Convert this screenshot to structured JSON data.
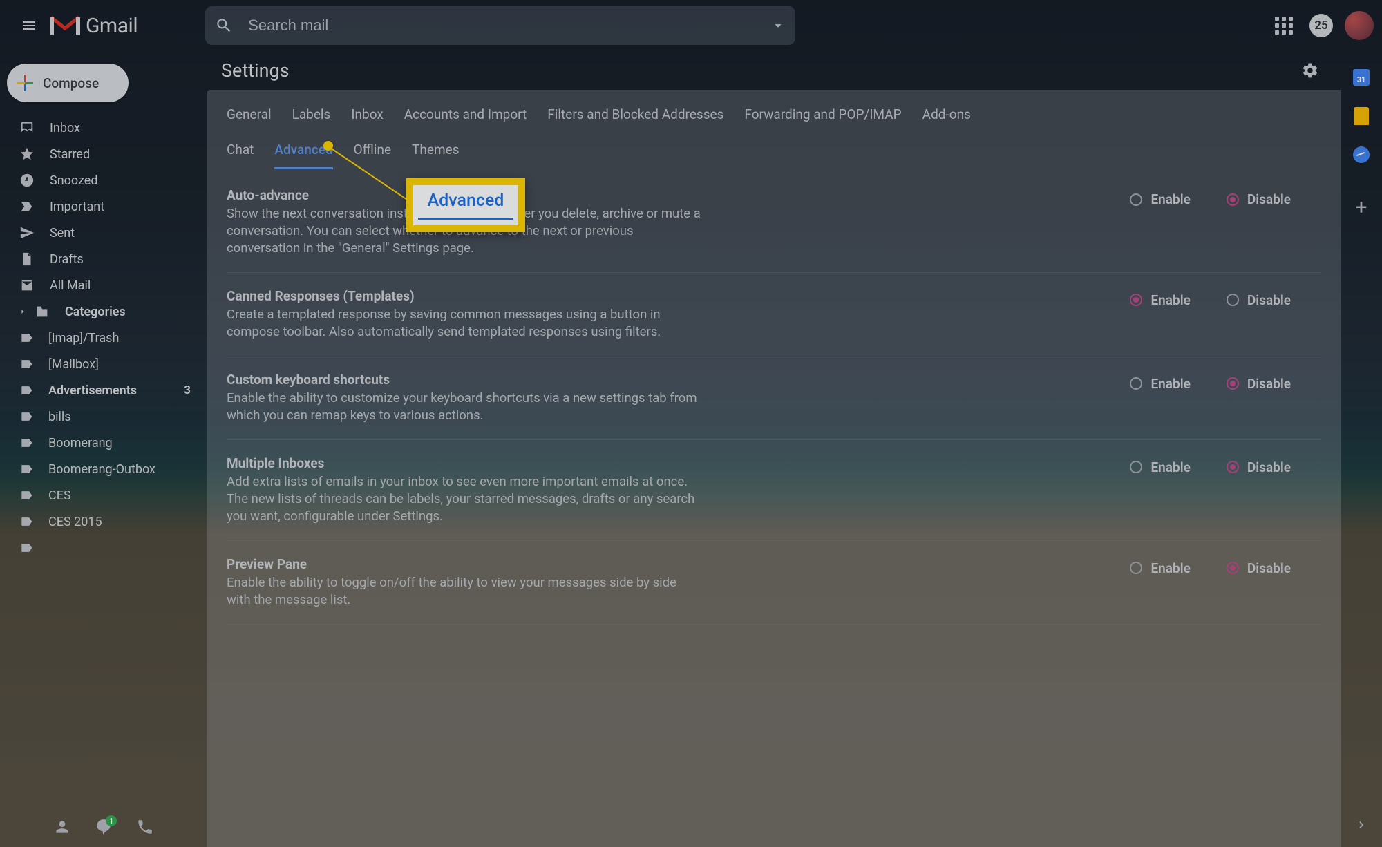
{
  "header": {
    "logo_text": "Gmail",
    "search_placeholder": "Search mail",
    "notif_count": "25"
  },
  "compose_label": "Compose",
  "sidebar": {
    "items": [
      {
        "label": "Inbox",
        "icon": "inbox"
      },
      {
        "label": "Starred",
        "icon": "star"
      },
      {
        "label": "Snoozed",
        "icon": "clock"
      },
      {
        "label": "Important",
        "icon": "important"
      },
      {
        "label": "Sent",
        "icon": "send"
      },
      {
        "label": "Drafts",
        "icon": "draft"
      },
      {
        "label": "All Mail",
        "icon": "mail"
      },
      {
        "label": "Categories",
        "icon": "cat",
        "bold": true,
        "expand": true
      },
      {
        "label": "[Imap]/Trash",
        "icon": "label"
      },
      {
        "label": "[Mailbox]",
        "icon": "label"
      },
      {
        "label": "Advertisements",
        "icon": "label",
        "bold": true,
        "count": "3"
      },
      {
        "label": "bills",
        "icon": "label"
      },
      {
        "label": "Boomerang",
        "icon": "label"
      },
      {
        "label": "Boomerang-Outbox",
        "icon": "label"
      },
      {
        "label": "CES",
        "icon": "label"
      },
      {
        "label": "CES 2015",
        "icon": "label"
      },
      {
        "label": "",
        "icon": "label"
      }
    ],
    "hangouts_count": "1"
  },
  "settings_title": "Settings",
  "tabs_row1": [
    "General",
    "Labels",
    "Inbox",
    "Accounts and Import",
    "Filters and Blocked Addresses",
    "Forwarding and POP/IMAP",
    "Add-ons"
  ],
  "tabs_row2": [
    "Chat",
    "Advanced",
    "Offline",
    "Themes"
  ],
  "active_tab": "Advanced",
  "enable_label": "Enable",
  "disable_label": "Disable",
  "settings": [
    {
      "key": "auto_advance",
      "title": "Auto-advance",
      "desc": "Show the next conversation instead of your inbox after you delete, archive or mute a conversation. You can select whether to advance to the next or previous conversation in the \"General\" Settings page.",
      "selected": "disable"
    },
    {
      "key": "canned",
      "title": "Canned Responses (Templates)",
      "desc": "Create a templated response by saving common messages using a button in compose toolbar. Also automatically send templated responses using filters.",
      "selected": "enable"
    },
    {
      "key": "shortcuts",
      "title": "Custom keyboard shortcuts",
      "desc": "Enable the ability to customize your keyboard shortcuts via a new settings tab from which you can remap keys to various actions.",
      "selected": "disable"
    },
    {
      "key": "multi_inbox",
      "title": "Multiple Inboxes",
      "desc": "Add extra lists of emails in your inbox to see even more important emails at once. The new lists of threads can be labels, your starred messages, drafts or any search you want, configurable under Settings.",
      "selected": "disable"
    },
    {
      "key": "preview",
      "title": "Preview Pane",
      "desc": "Enable the ability to toggle on/off the ability to view your messages side by side with the message list.",
      "selected": "disable"
    }
  ],
  "callout_label": "Advanced",
  "rail_calendar_day": "31"
}
